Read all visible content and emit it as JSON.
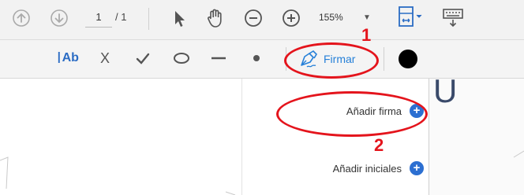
{
  "navigation": {
    "current_page": "1",
    "page_total": "/ 1",
    "zoom_level": "155%"
  },
  "sign_toolbar": {
    "firmar_label": "Firmar",
    "text_tool_label": "Ab",
    "cross_tool_label": "X"
  },
  "sign_menu": {
    "add_signature_label": "Añadir firma",
    "add_initials_label": "Añadir iniciales"
  },
  "annotations": {
    "callout_1": "1",
    "callout_2": "2"
  },
  "document": {
    "partial_text": "U"
  },
  "colors": {
    "accent_blue": "#2680d8",
    "plus_blue": "#2c6fd1",
    "annotation_red": "#e4141c",
    "fill_color_swatch": "#000000"
  },
  "icons": [
    "arrow-up-circle-icon",
    "arrow-down-circle-icon",
    "pointer-icon",
    "hand-icon",
    "zoom-out-icon",
    "zoom-in-icon",
    "fit-page-icon",
    "keyboard-icon",
    "text-field-icon",
    "cross-icon",
    "check-icon",
    "ellipse-icon",
    "line-icon",
    "dot-icon",
    "fountain-pen-icon",
    "color-swatch-icon",
    "plus-icon"
  ]
}
